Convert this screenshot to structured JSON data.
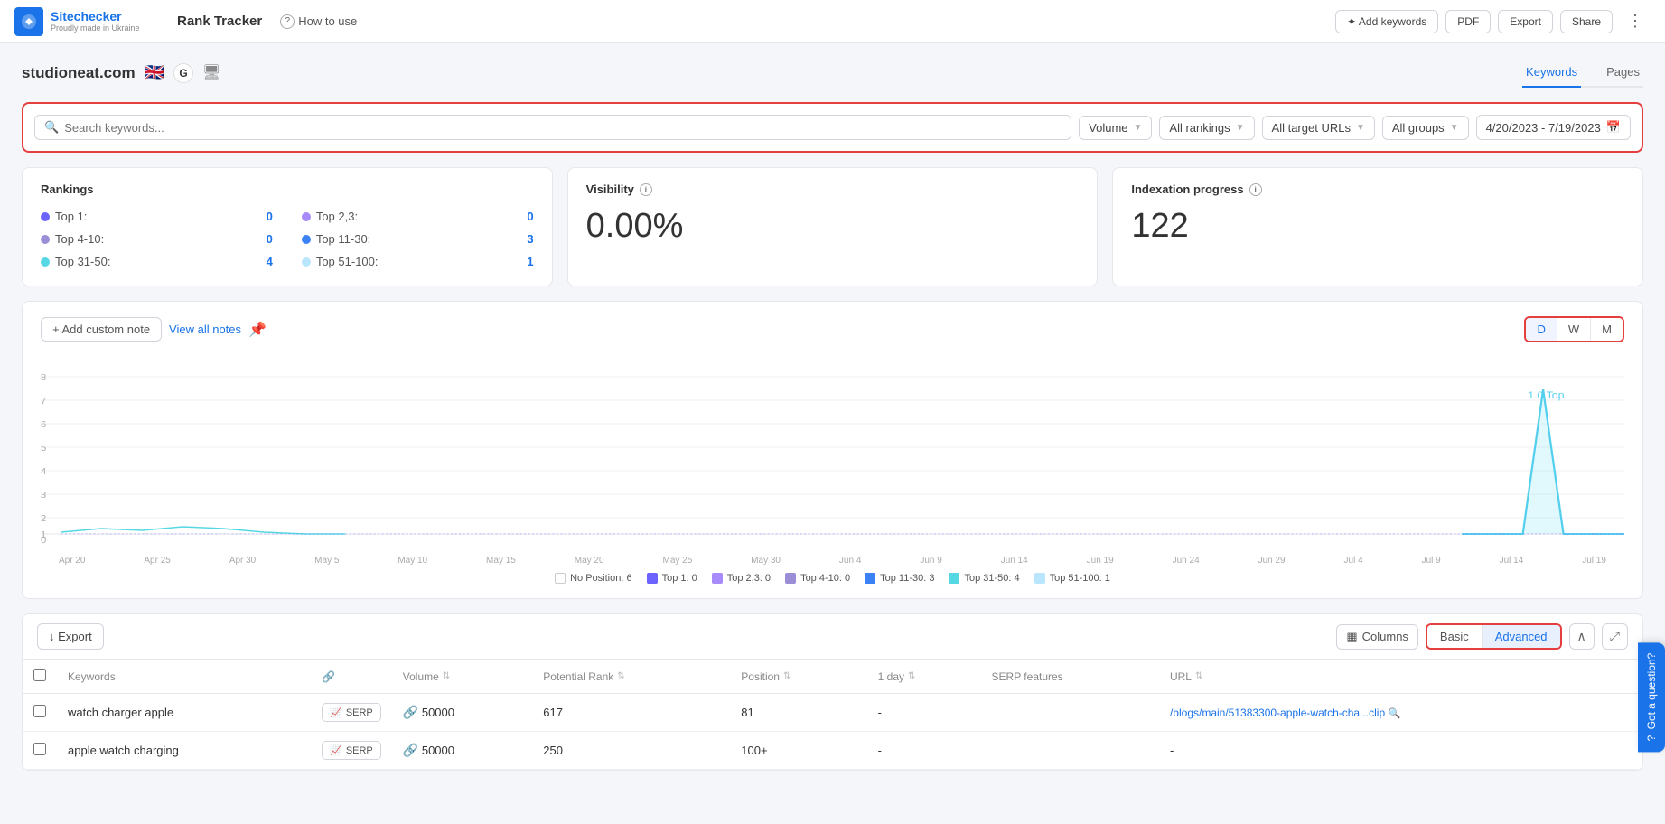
{
  "app": {
    "logo_text": "Sitechecker",
    "logo_sub": "Proudly made in Ukraine",
    "nav_title": "Rank Tracker",
    "how_to_use": "How to use"
  },
  "topnav_buttons": {
    "add_keywords": "✦ Add keywords",
    "pdf": "PDF",
    "export": "Export",
    "share": "Share"
  },
  "site": {
    "domain": "studioneat.com",
    "flag": "🇬🇧",
    "g_icon": "G"
  },
  "tabs": [
    {
      "id": "keywords",
      "label": "Keywords",
      "active": true
    },
    {
      "id": "pages",
      "label": "Pages",
      "active": false
    }
  ],
  "filters": {
    "search_placeholder": "Search keywords...",
    "volume_label": "Volume",
    "rankings_label": "All rankings",
    "urls_label": "All target URLs",
    "groups_label": "All groups",
    "date_range": "4/20/2023 - 7/19/2023"
  },
  "rankings": {
    "title": "Rankings",
    "items": [
      {
        "label": "Top 1:",
        "value": "0",
        "color": "#6c63ff",
        "col": 1
      },
      {
        "label": "Top 4-10:",
        "value": "0",
        "color": "#9b8ed6",
        "col": 1
      },
      {
        "label": "Top 31-50:",
        "value": "4",
        "color": "#56d8e4",
        "col": 1
      },
      {
        "label": "Top 2,3:",
        "value": "0",
        "color": "#a78bfa",
        "col": 2
      },
      {
        "label": "Top 11-30:",
        "value": "3",
        "color": "#3b82f6",
        "col": 2
      },
      {
        "label": "Top 51-100:",
        "value": "1",
        "color": "#bae6fd",
        "col": 2
      }
    ]
  },
  "visibility": {
    "title": "Visibility",
    "value": "0.00%"
  },
  "indexation": {
    "title": "Indexation progress",
    "value": "122"
  },
  "chart": {
    "add_note_label": "+ Add custom note",
    "view_notes_label": "View all notes",
    "dwm_buttons": [
      "D",
      "W",
      "M"
    ],
    "active_dwm": "D",
    "x_labels": [
      "Apr 20",
      "Apr 25",
      "Apr 30",
      "May 5",
      "May 10",
      "May 15",
      "May 20",
      "May 25",
      "May 30",
      "Jun 4",
      "Jun 9",
      "Jun 14",
      "Jun 19",
      "Jun 24",
      "Jun 29",
      "Jul 4",
      "Jul 9",
      "Jul 14",
      "Jul 19"
    ],
    "y_labels": [
      "8",
      "7",
      "6",
      "5",
      "4",
      "3",
      "2",
      "1",
      "0"
    ],
    "legend": [
      {
        "label": "No Position: 6",
        "color": "#e5e7eb",
        "checked": false
      },
      {
        "label": "Top 1: 0",
        "color": "#6c63ff",
        "checked": true
      },
      {
        "label": "Top 2,3: 0",
        "color": "#a78bfa",
        "checked": true
      },
      {
        "label": "Top 4-10: 0",
        "color": "#9b8ed6",
        "checked": true
      },
      {
        "label": "Top 11-30: 3",
        "color": "#3b82f6",
        "checked": true
      },
      {
        "label": "Top 31-50: 4",
        "color": "#56d8e4",
        "checked": true
      },
      {
        "label": "Top 51-100: 1",
        "color": "#bae6fd",
        "checked": true
      }
    ]
  },
  "table": {
    "export_label": "↓ Export",
    "columns_label": "Columns",
    "basic_label": "Basic",
    "advanced_label": "Advanced",
    "headers": [
      {
        "id": "checkbox",
        "label": ""
      },
      {
        "id": "keyword",
        "label": "Keywords"
      },
      {
        "id": "link",
        "label": ""
      },
      {
        "id": "volume",
        "label": "Volume"
      },
      {
        "id": "potential_rank",
        "label": "Potential Rank"
      },
      {
        "id": "position",
        "label": "Position"
      },
      {
        "id": "one_day",
        "label": "1 day"
      },
      {
        "id": "serp_features",
        "label": "SERP features"
      },
      {
        "id": "url",
        "label": "URL"
      }
    ],
    "rows": [
      {
        "keyword": "watch charger apple",
        "volume": "50000",
        "potential_rank": "617",
        "position": "81",
        "one_day": "-",
        "serp_features": "",
        "url": "/blogs/main/51383300-apple-watch-cha... clip",
        "url_display": "/blogs/main/51383300-apple-watch-cha...clip",
        "has_link": true
      },
      {
        "keyword": "apple watch charging",
        "volume": "50000",
        "potential_rank": "250",
        "position": "100+",
        "one_day": "-",
        "serp_features": "",
        "url": "-",
        "url_display": "-",
        "has_link": true
      }
    ]
  },
  "help": {
    "label": "Got a question?"
  }
}
